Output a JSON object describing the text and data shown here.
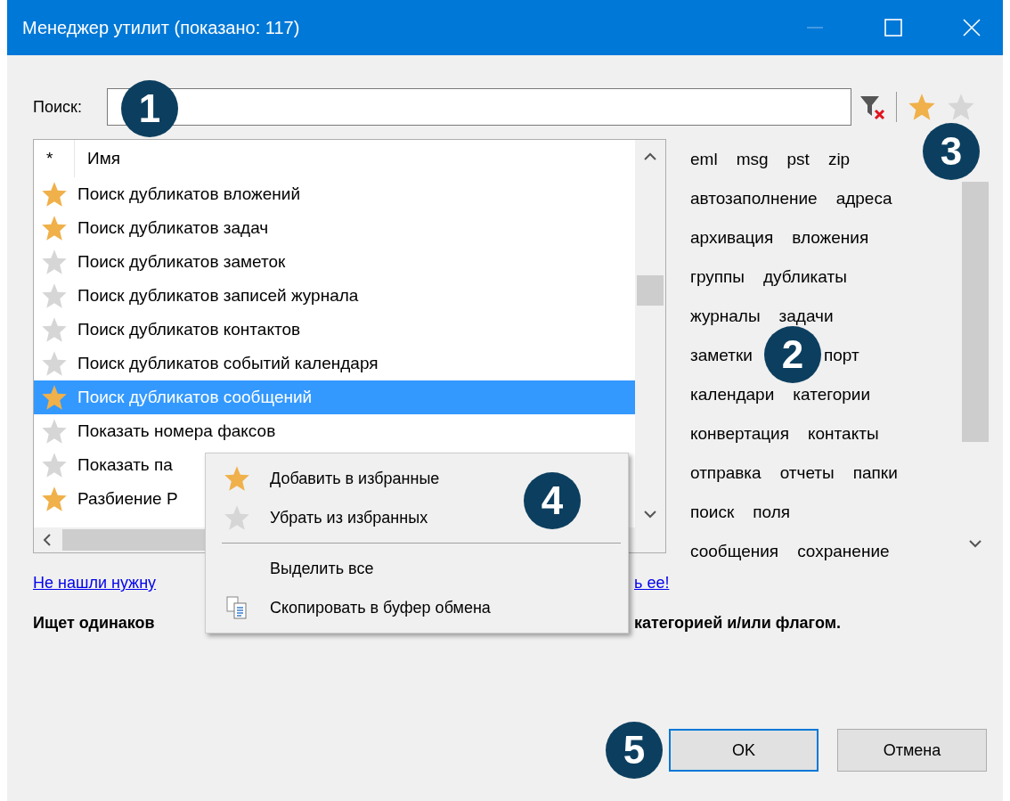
{
  "window": {
    "title": "Менеджер утилит (показано: 117)"
  },
  "search": {
    "label": "Поиск:"
  },
  "list": {
    "columns": [
      "*",
      "Имя"
    ],
    "rows": [
      {
        "name": "Поиск дубликатов вложений",
        "favorite": true,
        "selected": false
      },
      {
        "name": "Поиск дубликатов задач",
        "favorite": true,
        "selected": false
      },
      {
        "name": "Поиск дубликатов заметок",
        "favorite": false,
        "selected": false
      },
      {
        "name": "Поиск дубликатов записей журнала",
        "favorite": false,
        "selected": false
      },
      {
        "name": "Поиск дубликатов контактов",
        "favorite": false,
        "selected": false
      },
      {
        "name": "Поиск дубликатов событий календаря",
        "favorite": false,
        "selected": false
      },
      {
        "name": "Поиск дубликатов сообщений",
        "favorite": true,
        "selected": true
      },
      {
        "name": "Показать номера факсов",
        "favorite": false,
        "selected": false
      },
      {
        "name": "Показать па",
        "favorite": false,
        "selected": false
      },
      {
        "name": "Разбиение Р",
        "favorite": true,
        "selected": false
      }
    ]
  },
  "tag_rows": [
    [
      "eml",
      "msg",
      "pst",
      "zip"
    ],
    [
      "автозаполнение",
      "адреса"
    ],
    [
      "архивация",
      "вложения"
    ],
    [
      "группы",
      "дубликаты"
    ],
    [
      "журналы",
      "задачи"
    ],
    [
      "заметки",
      "порт"
    ],
    [
      "календари",
      "категории"
    ],
    [
      "конвертация",
      "контакты"
    ],
    [
      "отправка",
      "отчеты",
      "папки"
    ],
    [
      "поиск",
      "поля"
    ],
    [
      "сообщения",
      "сохранение"
    ]
  ],
  "link": {
    "before": "Не нашли нужну",
    "after": "ь ее!"
  },
  "description": {
    "before": "Ищет одинаков",
    "after": "категорией и/или флагом."
  },
  "context_menu": [
    {
      "kind": "add-favorite",
      "label": "Добавить в избранные"
    },
    {
      "kind": "remove-favorite",
      "label": "Убрать из избранных"
    },
    {
      "kind": "separator"
    },
    {
      "kind": "plain",
      "label": "Выделить все"
    },
    {
      "kind": "copy",
      "label": "Скопировать в буфер обмена"
    }
  ],
  "buttons": [
    {
      "label": "OK",
      "default": true
    },
    {
      "label": "Отмена",
      "default": false
    }
  ],
  "callouts": [
    "1",
    "2",
    "3",
    "4",
    "5"
  ]
}
